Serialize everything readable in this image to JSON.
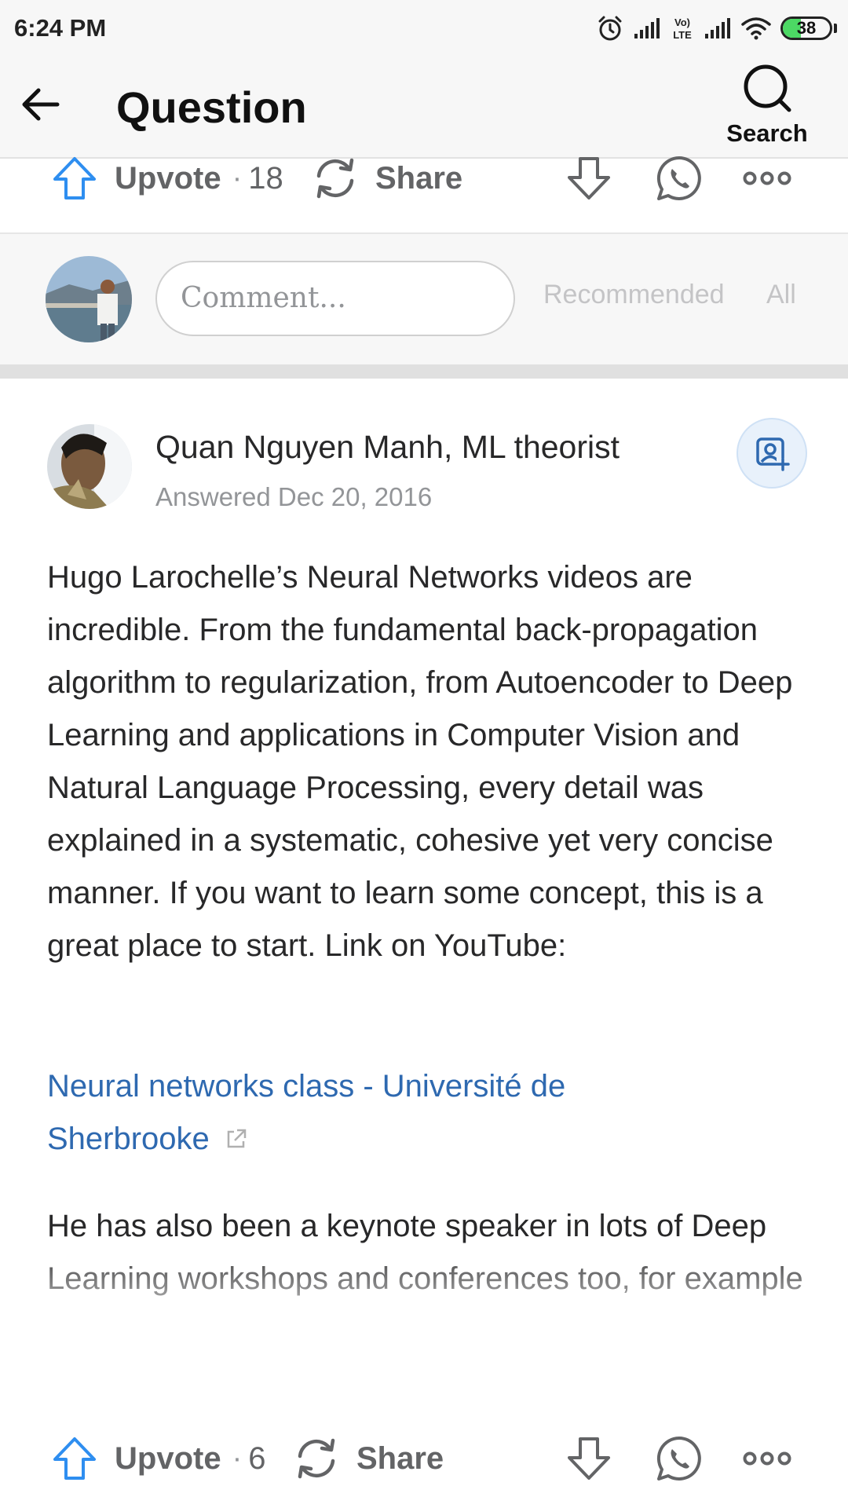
{
  "status_bar": {
    "time": "6:24 PM",
    "battery": "38",
    "battery_level": 0.38
  },
  "header": {
    "title": "Question",
    "search_label": "Search",
    "back_icon": "arrow-left-icon",
    "search_icon": "search-icon"
  },
  "top_actions": {
    "upvote_label": "Upvote",
    "upvote_count": "18",
    "share_label": "Share"
  },
  "comment_bar": {
    "placeholder": "Comment...",
    "filter_recommended": "Recommended",
    "filter_all": "All"
  },
  "answer": {
    "author": "Quan Nguyen Manh, ML theorist",
    "date": "Answered Dec 20, 2016",
    "paragraph1": "Hugo Larochelle’s Neural Networks videos are incredible. From the fundamental back-propagation algorithm to regularization, from Autoencoder to Deep Learning and applications in Computer Vision and Natural Language Processing, every detail was explained in a systematic, cohesive yet very concise manner. If you want to learn some concept, this is a great place to start. Link on YouTube:",
    "link_text": "Neural networks class - Université de Sherbrooke",
    "paragraph2": "He has also been a keynote speaker in lots of Deep Learning workshops and conferences too, for example"
  },
  "bottom_actions": {
    "upvote_label": "Upvote",
    "upvote_count": "6",
    "share_label": "Share"
  },
  "colors": {
    "upvote_blue": "#2e8ef0",
    "link_blue": "#2e69b0",
    "icon_gray": "#636466"
  }
}
